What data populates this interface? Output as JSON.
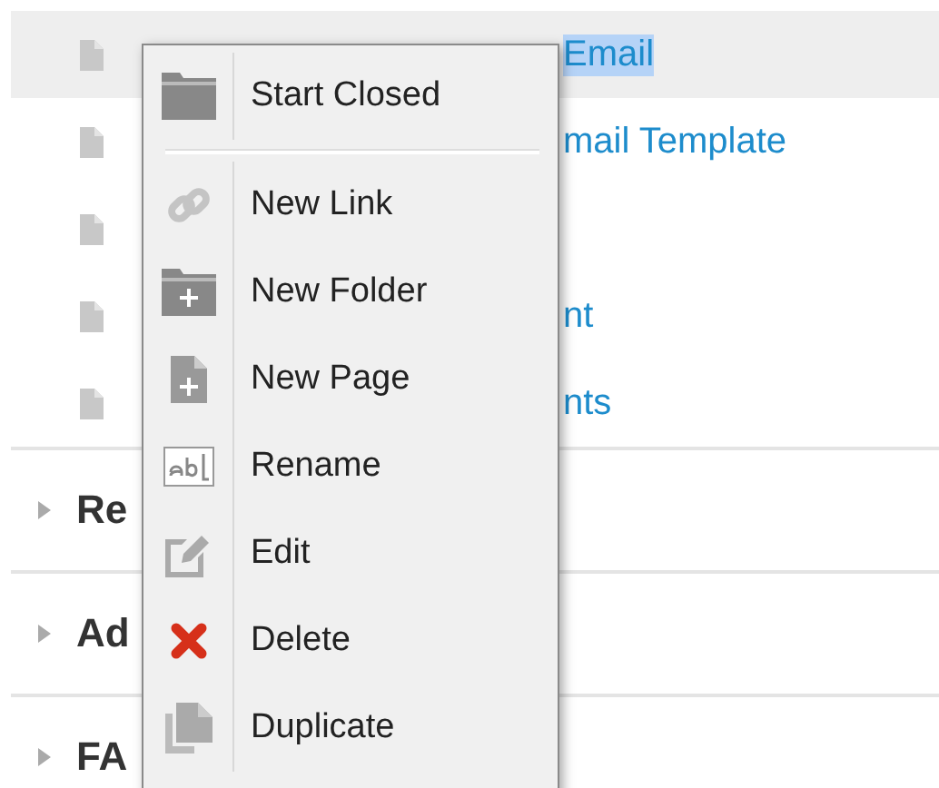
{
  "pages": [
    {
      "end": "Email",
      "selected": true
    },
    {
      "end": "mail Template",
      "selected": false
    },
    {
      "selected": false
    },
    {
      "end": "nt",
      "selected": false
    },
    {
      "end": "nts",
      "selected": false
    }
  ],
  "sections": [
    {
      "label": "Re",
      "expanded": false
    },
    {
      "label": "Ad",
      "expanded": false
    },
    {
      "label": "FA",
      "expanded": false
    }
  ],
  "context_menu": {
    "groups": [
      [
        {
          "kind": "start-closed",
          "label": "Start Closed"
        }
      ],
      [
        {
          "kind": "new-link",
          "label": "New Link"
        },
        {
          "kind": "new-folder",
          "label": "New Folder"
        },
        {
          "kind": "new-page",
          "label": "New Page"
        },
        {
          "kind": "rename",
          "label": "Rename"
        },
        {
          "kind": "edit",
          "label": "Edit"
        },
        {
          "kind": "delete",
          "label": "Delete"
        },
        {
          "kind": "duplicate",
          "label": "Duplicate"
        }
      ]
    ]
  }
}
